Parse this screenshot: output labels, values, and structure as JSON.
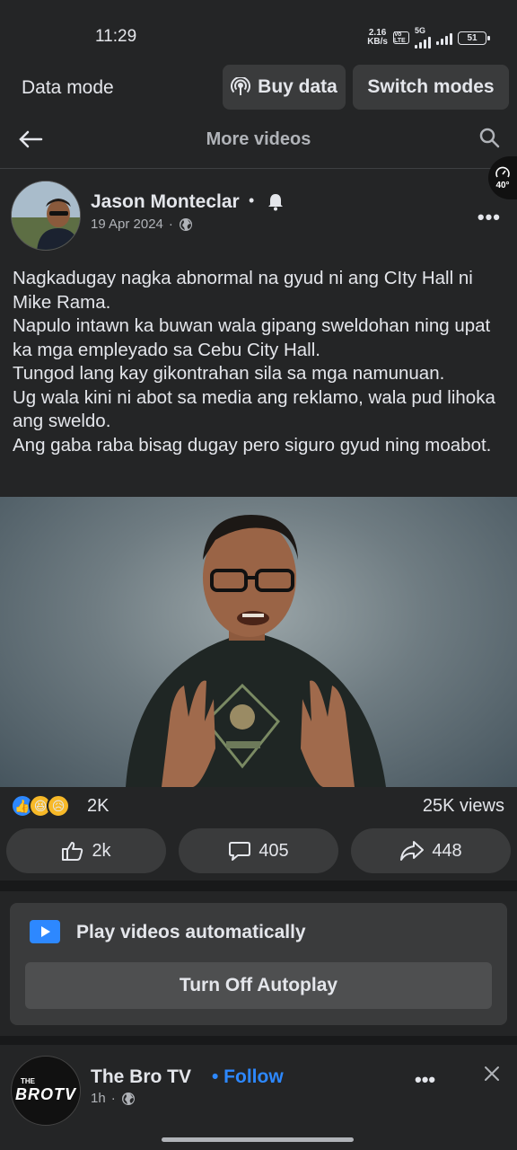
{
  "status_bar": {
    "time": "11:29",
    "net_speed_value": "2.16",
    "net_speed_unit": "KB/s",
    "volte": "Vo LTE",
    "network": "5G",
    "battery": "51"
  },
  "data_banner": {
    "label": "Data mode",
    "buy_data": "Buy data",
    "switch_modes": "Switch modes"
  },
  "header": {
    "title": "More videos",
    "speed_badge": "40°"
  },
  "post": {
    "author": "Jason Monteclar",
    "separator": "•",
    "date": "19 Apr 2024",
    "meta_dot": "·",
    "text": "Nagkadugay nagka abnormal na gyud ni ang CIty Hall ni Mike Rama.\nNapulo intawn ka buwan wala gipang sweldohan ning upat ka mga empleyado sa Cebu City Hall.\nTungod lang kay gikontrahan sila sa mga namunuan.\nUg wala kini ni abot sa media ang reklamo, wala pud lihoka ang sweldo.\nAng gaba raba bisag dugay pero siguro gyud ning moabot.",
    "more": "•••",
    "reaction_count": "2K",
    "views": "25K views",
    "actions": {
      "like": "2k",
      "comment": "405",
      "share": "448"
    }
  },
  "autoplay": {
    "title": "Play videos automatically",
    "button": "Turn Off Autoplay"
  },
  "next_post": {
    "author": "The Bro TV",
    "follow": "• Follow",
    "time": "1h",
    "meta_dot": "·",
    "more": "•••",
    "avatar_small": "THE",
    "avatar_logo": "BROTV"
  },
  "colors": {
    "background": "#242526",
    "accent": "#2d88ff",
    "button": "#3a3b3c"
  }
}
